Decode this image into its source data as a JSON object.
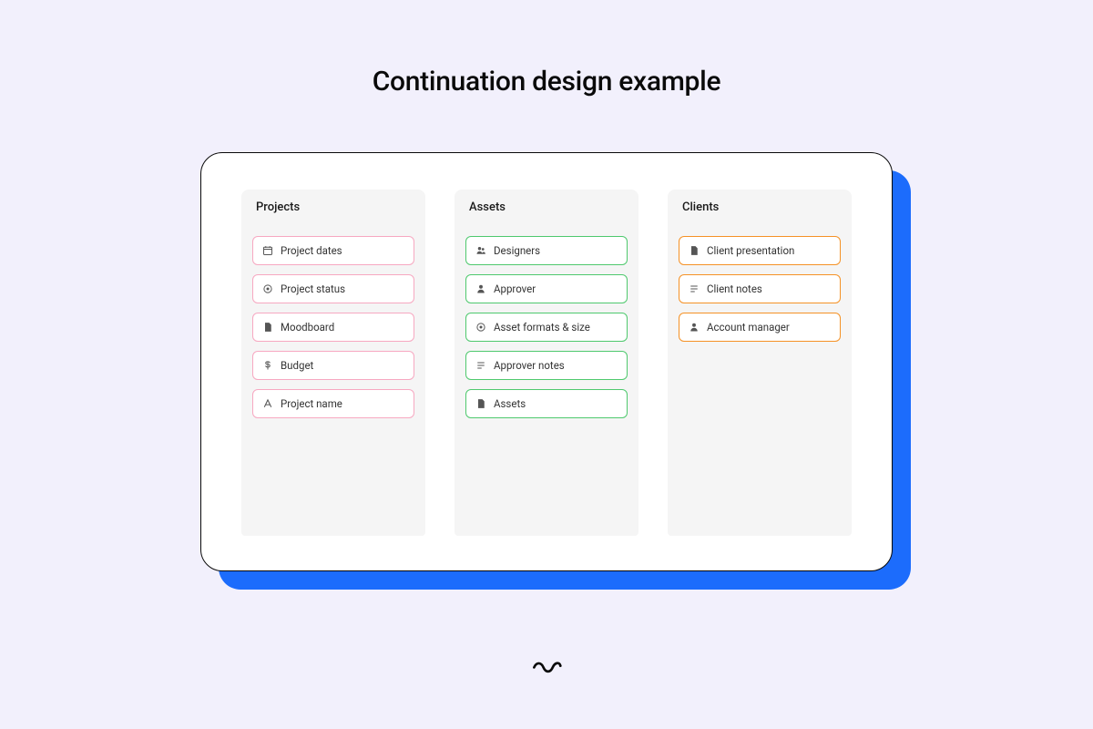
{
  "title": "Continuation design example",
  "columns": [
    {
      "header": "Projects",
      "class": "col-projects",
      "items": [
        {
          "icon": "calendar-icon",
          "label": "Project dates"
        },
        {
          "icon": "status-icon",
          "label": "Project status"
        },
        {
          "icon": "document-icon",
          "label": "Moodboard"
        },
        {
          "icon": "dollar-icon",
          "label": "Budget"
        },
        {
          "icon": "text-a-icon",
          "label": "Project name"
        }
      ]
    },
    {
      "header": "Assets",
      "class": "col-assets",
      "items": [
        {
          "icon": "people-icon",
          "label": "Designers"
        },
        {
          "icon": "person-icon",
          "label": "Approver"
        },
        {
          "icon": "status-icon",
          "label": "Asset formats & size"
        },
        {
          "icon": "notes-icon",
          "label": "Approver notes"
        },
        {
          "icon": "document-icon",
          "label": "Assets"
        }
      ]
    },
    {
      "header": "Clients",
      "class": "col-clients",
      "items": [
        {
          "icon": "document-icon",
          "label": "Client presentation"
        },
        {
          "icon": "notes-icon",
          "label": "Client notes"
        },
        {
          "icon": "person-icon",
          "label": "Account manager"
        }
      ]
    }
  ],
  "colors": {
    "background": "#f2f0fc",
    "accent": "#1c6cfc",
    "projects_border": "#f7a8c1",
    "assets_border": "#4fc96e",
    "clients_border": "#f59226"
  }
}
